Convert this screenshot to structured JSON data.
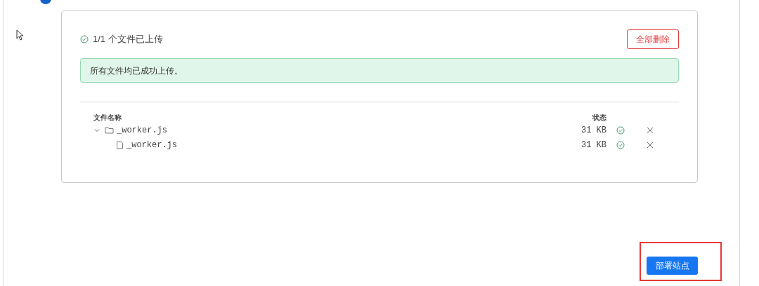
{
  "upload_panel": {
    "summary": "1/1 个文件已上传",
    "delete_all_button": "全部删除",
    "alert": "所有文件均已成功上传。",
    "columns": [
      "文件名称",
      "状态"
    ],
    "files": [
      {
        "kind": "folder",
        "name": "_worker.js",
        "size": "31 KB",
        "expanded": true,
        "uploaded": true,
        "children": [
          {
            "kind": "file",
            "name": "_worker.js",
            "size": "31 KB",
            "uploaded": true
          }
        ]
      }
    ]
  },
  "deploy_button": "部署站点",
  "highlight": true
}
